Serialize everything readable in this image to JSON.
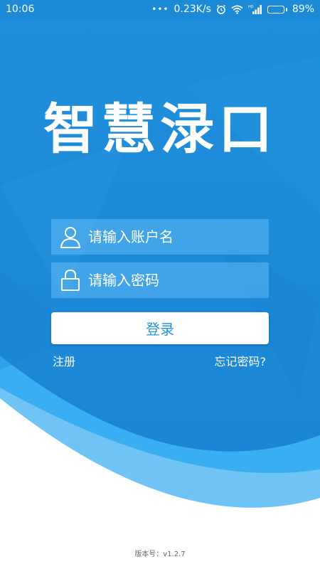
{
  "status_bar": {
    "time": "10:06",
    "dots": "•••",
    "net_speed": "0.23K/s",
    "battery_percent": "89%",
    "battery_level": 0.89,
    "icons": [
      "alarm-icon",
      "wifi-icon",
      "hd-signal-icon",
      "battery-icon"
    ]
  },
  "app": {
    "title": "智慧渌口"
  },
  "login": {
    "username_placeholder": "请输入账户名",
    "username_value": "",
    "password_placeholder": "请输入密码",
    "password_value": "",
    "login_label": "登录",
    "register_label": "注册",
    "forgot_label": "忘记密码?"
  },
  "footer": {
    "version": "版本号：v1.2.7"
  },
  "colors": {
    "primary_blue": "#1c8ad6",
    "light_blue": "#3aaef2",
    "button_text": "#2294e0",
    "white": "#ffffff"
  }
}
